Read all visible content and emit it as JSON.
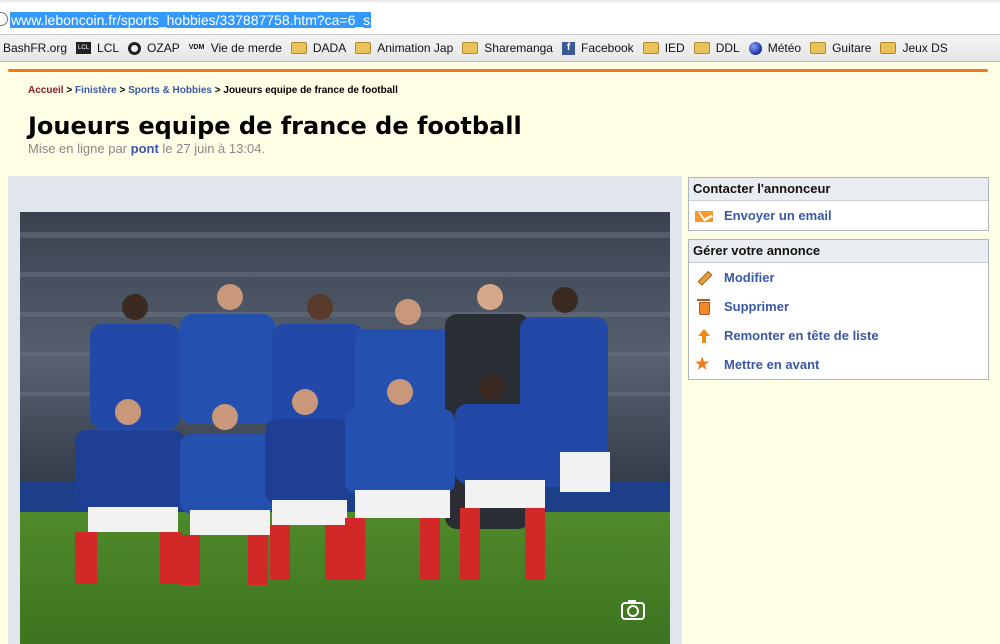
{
  "browser": {
    "url": "www.leboncoin.fr/sports_hobbies/337887758.htm?ca=6_s"
  },
  "bookmarks": [
    {
      "label": "BashFR.org",
      "icon": "none"
    },
    {
      "label": "LCL",
      "icon": "lcl-icon"
    },
    {
      "label": "OZAP",
      "icon": "ozap-icon"
    },
    {
      "label": "Vie de merde",
      "icon": "vdm-icon"
    },
    {
      "label": "DADA",
      "icon": "folder-icon"
    },
    {
      "label": "Animation Jap",
      "icon": "folder-icon"
    },
    {
      "label": "Sharemanga",
      "icon": "folder-icon"
    },
    {
      "label": "Facebook",
      "icon": "facebook-icon"
    },
    {
      "label": "IED",
      "icon": "folder-icon"
    },
    {
      "label": "DDL",
      "icon": "folder-icon"
    },
    {
      "label": "Météo",
      "icon": "meteo-icon"
    },
    {
      "label": "Guitare",
      "icon": "folder-icon"
    },
    {
      "label": "Jeux DS",
      "icon": "folder-icon"
    }
  ],
  "bookmark_icon_texts": {
    "lcl": "LCL",
    "vdm": "VDM",
    "facebook": "f"
  },
  "breadcrumb": {
    "home": "Accueil",
    "sep": ">",
    "region": "Finistère",
    "category": "Sports & Hobbies",
    "current": "Joueurs equipe de france de football"
  },
  "ad": {
    "title": "Joueurs equipe de france de football",
    "posted_prefix": "Mise en ligne par",
    "author": "pont",
    "posted_suffix": "le 27 juin à 13:04."
  },
  "contact_box": {
    "header": "Contacter l'annonceur",
    "email_label": "Envoyer un email"
  },
  "manage_box": {
    "header": "Gérer votre annonce",
    "items": [
      "Modifier",
      "Supprimer",
      "Remonter en tête de liste",
      "Mettre en avant"
    ]
  },
  "colors": {
    "accent": "#f07a1a",
    "link": "#3a58a8",
    "page_bg": "#ffffe6",
    "url_highlight": "#3399ff"
  }
}
